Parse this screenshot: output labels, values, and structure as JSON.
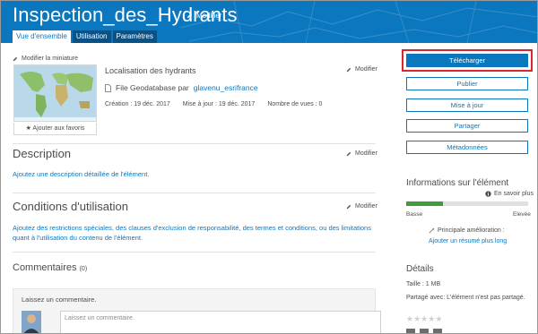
{
  "header": {
    "title": "Inspection_des_Hydrants",
    "edit_label": "Modifier",
    "tabs": [
      {
        "label": "Vue d'ensemble",
        "active": true
      },
      {
        "label": "Utilisation",
        "active": false
      },
      {
        "label": "Paramètres",
        "active": false
      }
    ]
  },
  "thumbnail": {
    "edit_label": "Modifier la miniature",
    "favorite_label": "Ajouter aux favoris"
  },
  "summary": {
    "title": "Localisation des hydrants",
    "edit_label": "Modifier",
    "file_type": "File Geodatabase par",
    "owner": "glavenu_esrifrance",
    "created": "Création : 19 déc. 2017",
    "updated": "Mise à jour : 19 déc. 2017",
    "views": "Nombre de vues : 0"
  },
  "description": {
    "heading": "Description",
    "edit_label": "Modifier",
    "link": "Ajoutez une description détaillée de l'élément."
  },
  "terms": {
    "heading": "Conditions d'utilisation",
    "edit_label": "Modifier",
    "link": "Ajoutez des restrictions spéciales, des clauses d'exclusion de responsabilité, des termes et conditions, ou des limitations quant à l'utilisation du contenu de l'élément."
  },
  "comments": {
    "heading": "Commentaires",
    "count": "(0)",
    "prompt": "Laissez un commentaire.",
    "placeholder": "Laissez un commentaire."
  },
  "actions": {
    "download": "Télécharger",
    "publish": "Publier",
    "update": "Mise à jour",
    "share": "Partager",
    "metadata": "Métadonnées"
  },
  "info": {
    "heading": "Informations sur l'élément",
    "learn_more": "En savoir plus",
    "low_label": "Basse",
    "high_label": "Elevée",
    "score_fraction": 0.3,
    "improve_label": "Principale amélioration :",
    "improve_link": "Ajouter un résumé plus long"
  },
  "details": {
    "heading": "Détails",
    "size": "Taille : 1 MB",
    "sharing": "Partagé avec: L'élément n'est pas partagé."
  },
  "colors": {
    "header_blue": "#0b77be",
    "tab_dark": "#08528a",
    "highlight_red": "#d9262f",
    "score_green": "#3f9b3e"
  }
}
